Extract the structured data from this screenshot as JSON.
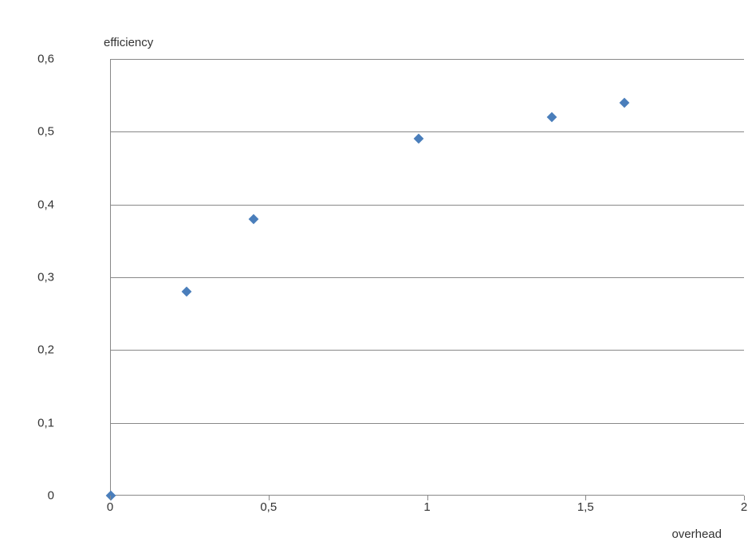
{
  "chart_data": {
    "type": "scatter",
    "x": [
      0,
      0.24,
      0.45,
      0.97,
      1.39,
      1.62
    ],
    "y": [
      0,
      0.28,
      0.38,
      0.49,
      0.52,
      0.54
    ],
    "xlabel": "overhead",
    "ylabel": "efficiency",
    "xlim": [
      0,
      2
    ],
    "ylim": [
      0,
      0.6
    ],
    "xticks": [
      0,
      0.5,
      1,
      1.5,
      2
    ],
    "yticks": [
      0,
      0.1,
      0.2,
      0.3,
      0.4,
      0.5,
      0.6
    ],
    "xtick_labels": [
      "0",
      "0,5",
      "1",
      "1,5",
      "2"
    ],
    "ytick_labels": [
      "0",
      "0,1",
      "0,2",
      "0,3",
      "0,4",
      "0,5",
      "0,6"
    ],
    "title": "",
    "grid": "y"
  }
}
